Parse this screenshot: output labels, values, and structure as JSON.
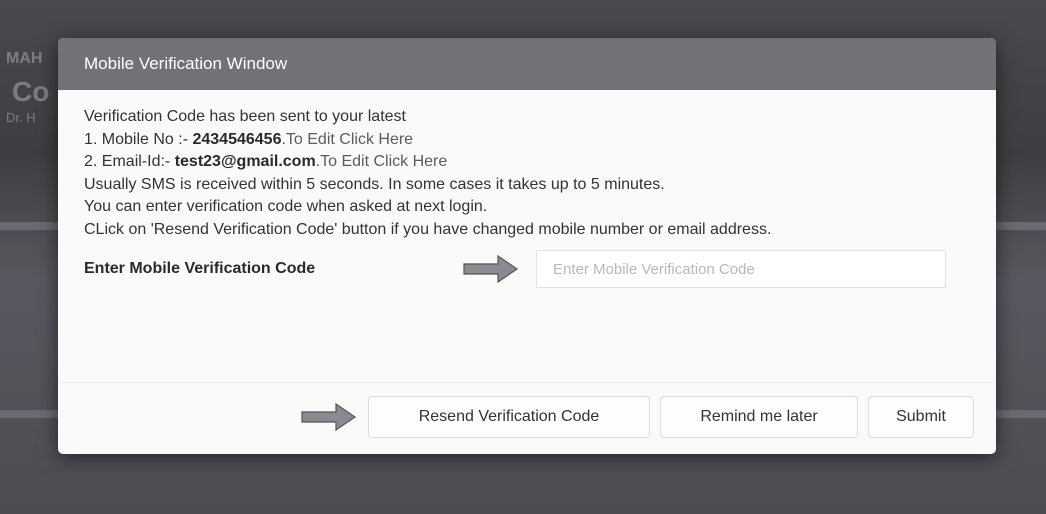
{
  "background": {
    "text_1": "MAH",
    "text_2": "Co",
    "text_3": "Dr. H"
  },
  "modal": {
    "title": "Mobile Verification Window",
    "intro": "Verification Code has been sent to your latest",
    "mobile_prefix": "1. Mobile No :- ",
    "mobile_number": "2434546456",
    "mobile_edit": ".To Edit Click Here",
    "email_prefix": "2. Email-Id:- ",
    "email_address": "test23@gmail.com",
    "email_edit": ".To Edit Click Here",
    "info_sms": "Usually SMS is received within 5 seconds. In some cases it takes up to 5 minutes.",
    "info_login": "You can enter verification code when asked at next login.",
    "info_resend": "CLick on 'Resend Verification Code' button if you have changed mobile number or email address.",
    "code_label": "Enter Mobile Verification Code",
    "code_placeholder": "Enter Mobile Verification Code",
    "code_value": ""
  },
  "footer": {
    "resend_label": "Resend Verification Code",
    "remind_label": "Remind me later",
    "submit_label": "Submit"
  },
  "icons": {
    "arrow": "right-arrow-icon"
  },
  "colors": {
    "header_bg": "#727276",
    "modal_bg": "#fafafb",
    "arrow_fill": "#8a8a90"
  }
}
